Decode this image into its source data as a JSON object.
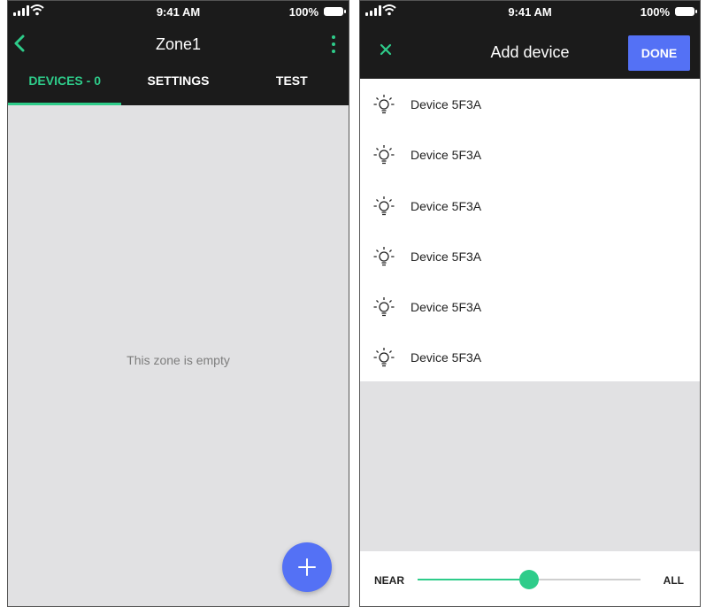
{
  "status_bar": {
    "time": "9:41 AM",
    "battery": "100%"
  },
  "zone_screen": {
    "title": "Zone1",
    "tabs": [
      {
        "label": "DEVICES - 0",
        "active": true
      },
      {
        "label": "SETTINGS",
        "active": false
      },
      {
        "label": "TEST",
        "active": false
      }
    ],
    "empty_message": "This zone is empty"
  },
  "add_device_screen": {
    "title": "Add device",
    "done_label": "DONE",
    "devices": [
      {
        "name": "Device  5F3A"
      },
      {
        "name": "Device  5F3A"
      },
      {
        "name": "Device  5F3A"
      },
      {
        "name": "Device  5F3A"
      },
      {
        "name": "Device  5F3A"
      },
      {
        "name": "Device  5F3A"
      }
    ],
    "range": {
      "min_label": "NEAR",
      "max_label": "ALL",
      "value": 0.5
    }
  },
  "colors": {
    "accent": "#2ecc8a",
    "primary": "#5471f5",
    "bar": "#1b1b1b",
    "empty_bg": "#e1e1e3"
  },
  "icons": [
    "cellular-signal-icon",
    "wifi-icon",
    "battery-icon",
    "chevron-left-icon",
    "more-vertical-icon",
    "plus-icon",
    "close-icon",
    "lightbulb-icon"
  ]
}
